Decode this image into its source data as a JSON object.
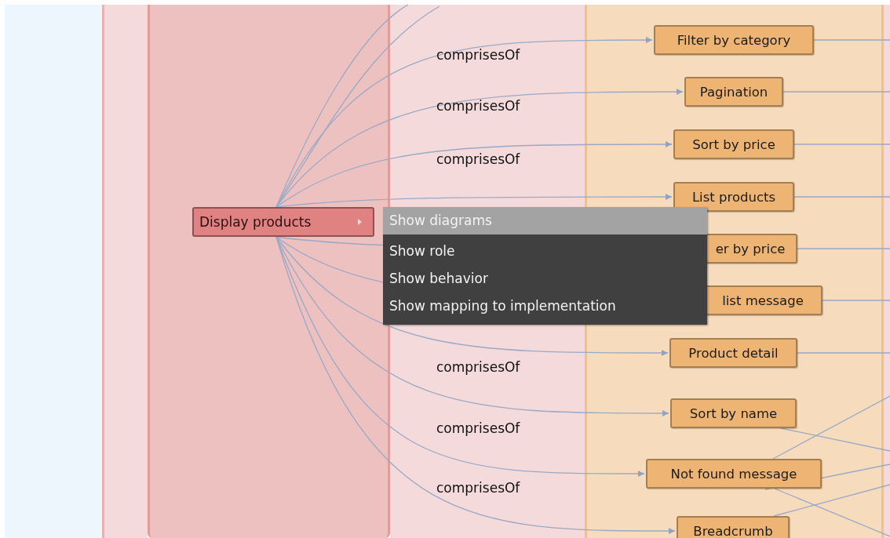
{
  "source_node": {
    "label": "Display products"
  },
  "context_menu": {
    "items": [
      {
        "label": "Show diagrams",
        "selected": true
      },
      {
        "label": "Show role",
        "selected": false
      },
      {
        "label": "Show behavior",
        "selected": false
      },
      {
        "label": "Show mapping to implementation",
        "selected": false
      }
    ]
  },
  "edge_labels": [
    "comprisesOf",
    "comprisesOf",
    "comprisesOf",
    "comprisesOf",
    "comprisesOf",
    "comprisesOf"
  ],
  "target_nodes": [
    {
      "label": "Filter by category"
    },
    {
      "label": "Pagination"
    },
    {
      "label": "Sort by price"
    },
    {
      "label": "List products"
    },
    {
      "label": "er by price"
    },
    {
      "label": "list message"
    },
    {
      "label": "Product detail"
    },
    {
      "label": "Sort by name"
    },
    {
      "label": "Not found message"
    },
    {
      "label": "Breadcrumb"
    }
  ]
}
